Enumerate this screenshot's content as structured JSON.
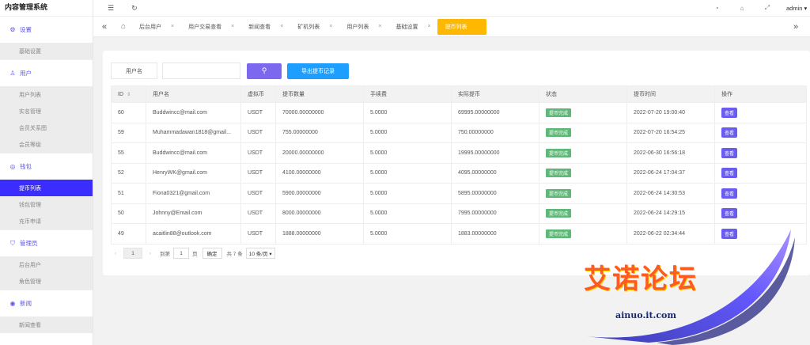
{
  "app": {
    "title": "内容管理系统"
  },
  "sidebar": {
    "groups": [
      {
        "label": "设置",
        "icon": "gear-icon",
        "items": [
          {
            "label": "基础设置",
            "active": false
          }
        ]
      },
      {
        "label": "用户",
        "icon": "user-icon",
        "items": [
          {
            "label": "用户列表",
            "active": false
          },
          {
            "label": "实名管理",
            "active": false
          },
          {
            "label": "会员关系图",
            "active": false
          },
          {
            "label": "会员等级",
            "active": false
          }
        ]
      },
      {
        "label": "钱包",
        "icon": "wallet-icon",
        "items": [
          {
            "label": "提币列表",
            "active": true
          },
          {
            "label": "钱包管理",
            "active": false
          },
          {
            "label": "充币申请",
            "active": false
          }
        ]
      },
      {
        "label": "管理员",
        "icon": "shield-icon",
        "items": [
          {
            "label": "后台用户",
            "active": false
          },
          {
            "label": "角色管理",
            "active": false
          }
        ]
      },
      {
        "label": "新闻",
        "icon": "news-icon",
        "items": [
          {
            "label": "新闻查看",
            "active": false
          }
        ]
      }
    ]
  },
  "topbar": {
    "user": "admin",
    "user_caret": "▾"
  },
  "tabs": [
    {
      "label": "后台用户",
      "active": false
    },
    {
      "label": "用户交易查看",
      "active": false
    },
    {
      "label": "新闻查看",
      "active": false
    },
    {
      "label": "矿机列表",
      "active": false
    },
    {
      "label": "用户列表",
      "active": false
    },
    {
      "label": "基础设置",
      "active": false
    },
    {
      "label": "提币列表",
      "active": true
    }
  ],
  "search": {
    "label": "用户名",
    "value": "",
    "export_label": "导出提币记录"
  },
  "table": {
    "columns": [
      "ID",
      "用户名",
      "虚拟币",
      "提币数量",
      "手续费",
      "实际提币",
      "状态",
      "提币时间",
      "操作"
    ],
    "rows": [
      [
        "60",
        "Buddwincc@mail.com",
        "USDT",
        "70000.00000000",
        "5.0000",
        "69995.00000000",
        "提币完成",
        "2022-07-20 19:00:40",
        "查看"
      ],
      [
        "59",
        "Muhammadawan1818@gmail...",
        "USDT",
        "755.00000000",
        "5.0000",
        "750.00000000",
        "提币完成",
        "2022-07-20 16:54:25",
        "查看"
      ],
      [
        "55",
        "Buddwincc@mail.com",
        "USDT",
        "20000.00000000",
        "5.0000",
        "19995.00000000",
        "提币完成",
        "2022-06-30 16:56:18",
        "查看"
      ],
      [
        "52",
        "HenryWK@gmail.com",
        "USDT",
        "4100.00000000",
        "5.0000",
        "4095.00000000",
        "提币完成",
        "2022-06-24 17:04:37",
        "查看"
      ],
      [
        "51",
        "Fiona0321@gmail.com",
        "USDT",
        "5900.00000000",
        "5.0000",
        "5895.00000000",
        "提币完成",
        "2022-06-24 14:30:53",
        "查看"
      ],
      [
        "50",
        "Johnny@Email.com",
        "USDT",
        "8000.00000000",
        "5.0000",
        "7995.00000000",
        "提币完成",
        "2022-06-24 14:29:15",
        "查看"
      ],
      [
        "49",
        "acaitlin88@outlook.com",
        "USDT",
        "1888.00000000",
        "5.0000",
        "1883.00000000",
        "提币完成",
        "2022-06-22 02:34:44",
        "查看"
      ]
    ]
  },
  "pager": {
    "prev": "‹",
    "current": "1",
    "next": "›",
    "goto_label": "到第",
    "goto_value": "1",
    "page_unit": "页",
    "confirm": "确定",
    "total": "共 7 条",
    "page_size": "10 条/页 ▾"
  },
  "watermark": {
    "text": "艾诺论坛",
    "sub": "ainuo.it.com"
  },
  "colors": {
    "accent": "#3b2cff",
    "active_tab": "#ffb800",
    "status_done": "#5fb878",
    "export": "#1e9fff",
    "search": "#7b68ee"
  }
}
